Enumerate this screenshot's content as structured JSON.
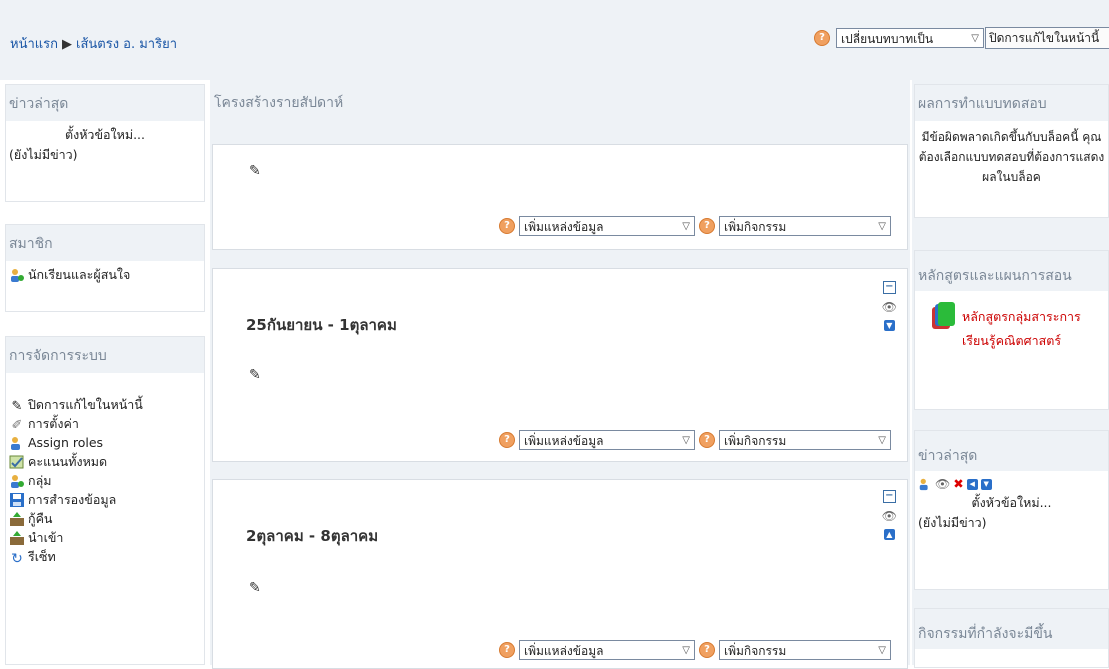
{
  "breadcrumb": {
    "home": "หน้าแรก",
    "separator": "▶",
    "course": "เส้นตรง อ. มาริยา"
  },
  "topright": {
    "role_select": "เปลี่ยนบทบาทเป็น",
    "edit_button": "ปิดการแก้ไขในหน้านี้"
  },
  "left": {
    "news": {
      "title": "ข่าวล่าสุด",
      "add_topic": "ตั้งหัวข้อใหม่...",
      "empty": "(ยังไม่มีข่าว)"
    },
    "members": {
      "title": "สมาชิก",
      "item": "นักเรียนและผู้สนใจ"
    },
    "admin": {
      "title": "การจัดการระบบ",
      "items": [
        {
          "label": "ปิดการแก้ไขในหน้านี้",
          "icon": "pencil-icon"
        },
        {
          "label": "การตั้งค่า",
          "icon": "wrench-icon"
        },
        {
          "label": "Assign roles",
          "icon": "roles-icon"
        },
        {
          "label": "คะแนนทั้งหมด",
          "icon": "grades-icon"
        },
        {
          "label": "กลุ่ม",
          "icon": "groups-icon"
        },
        {
          "label": "การสำรองข้อมูล",
          "icon": "backup-icon"
        },
        {
          "label": "กู้คืน",
          "icon": "restore-icon"
        },
        {
          "label": "นำเข้า",
          "icon": "import-icon"
        },
        {
          "label": "รีเซ็ท",
          "icon": "reset-icon"
        }
      ]
    }
  },
  "main": {
    "heading": "โครงสร้างรายสัปดาห์",
    "add_resource": "เพิ่มแหล่งข้อมูล",
    "add_activity": "เพิ่มกิจกรรม",
    "sections": [
      {
        "title": ""
      },
      {
        "title": "25กันยายน - 1ตุลาคม"
      },
      {
        "title": "2ตุลาคม - 8ตุลาคม"
      }
    ]
  },
  "right": {
    "quiz": {
      "title": "ผลการทำแบบทดสอบ",
      "message": "มีข้อผิดพลาดเกิดขึ้นกับบล็อคนี้ คุณต้องเลือกแบบทดสอบที่ต้องการแสดงผลในบล็อค"
    },
    "curriculum": {
      "title": "หลักสูตรและแผนการสอน",
      "link": "หลักสูตรกลุ่มสาระการเรียนรู้คณิตศาสตร์"
    },
    "news": {
      "title": "ข่าวล่าสุด",
      "add_topic": "ตั้งหัวข้อใหม่...",
      "empty": "(ยังไม่มีข่าว)"
    },
    "upcoming": {
      "title": "กิจกรรมที่กำลังจะมีขึ้น"
    }
  },
  "colors": {
    "link": "#1a56a6",
    "header_bg": "#eef2f6",
    "accent_red": "#cc0000"
  }
}
